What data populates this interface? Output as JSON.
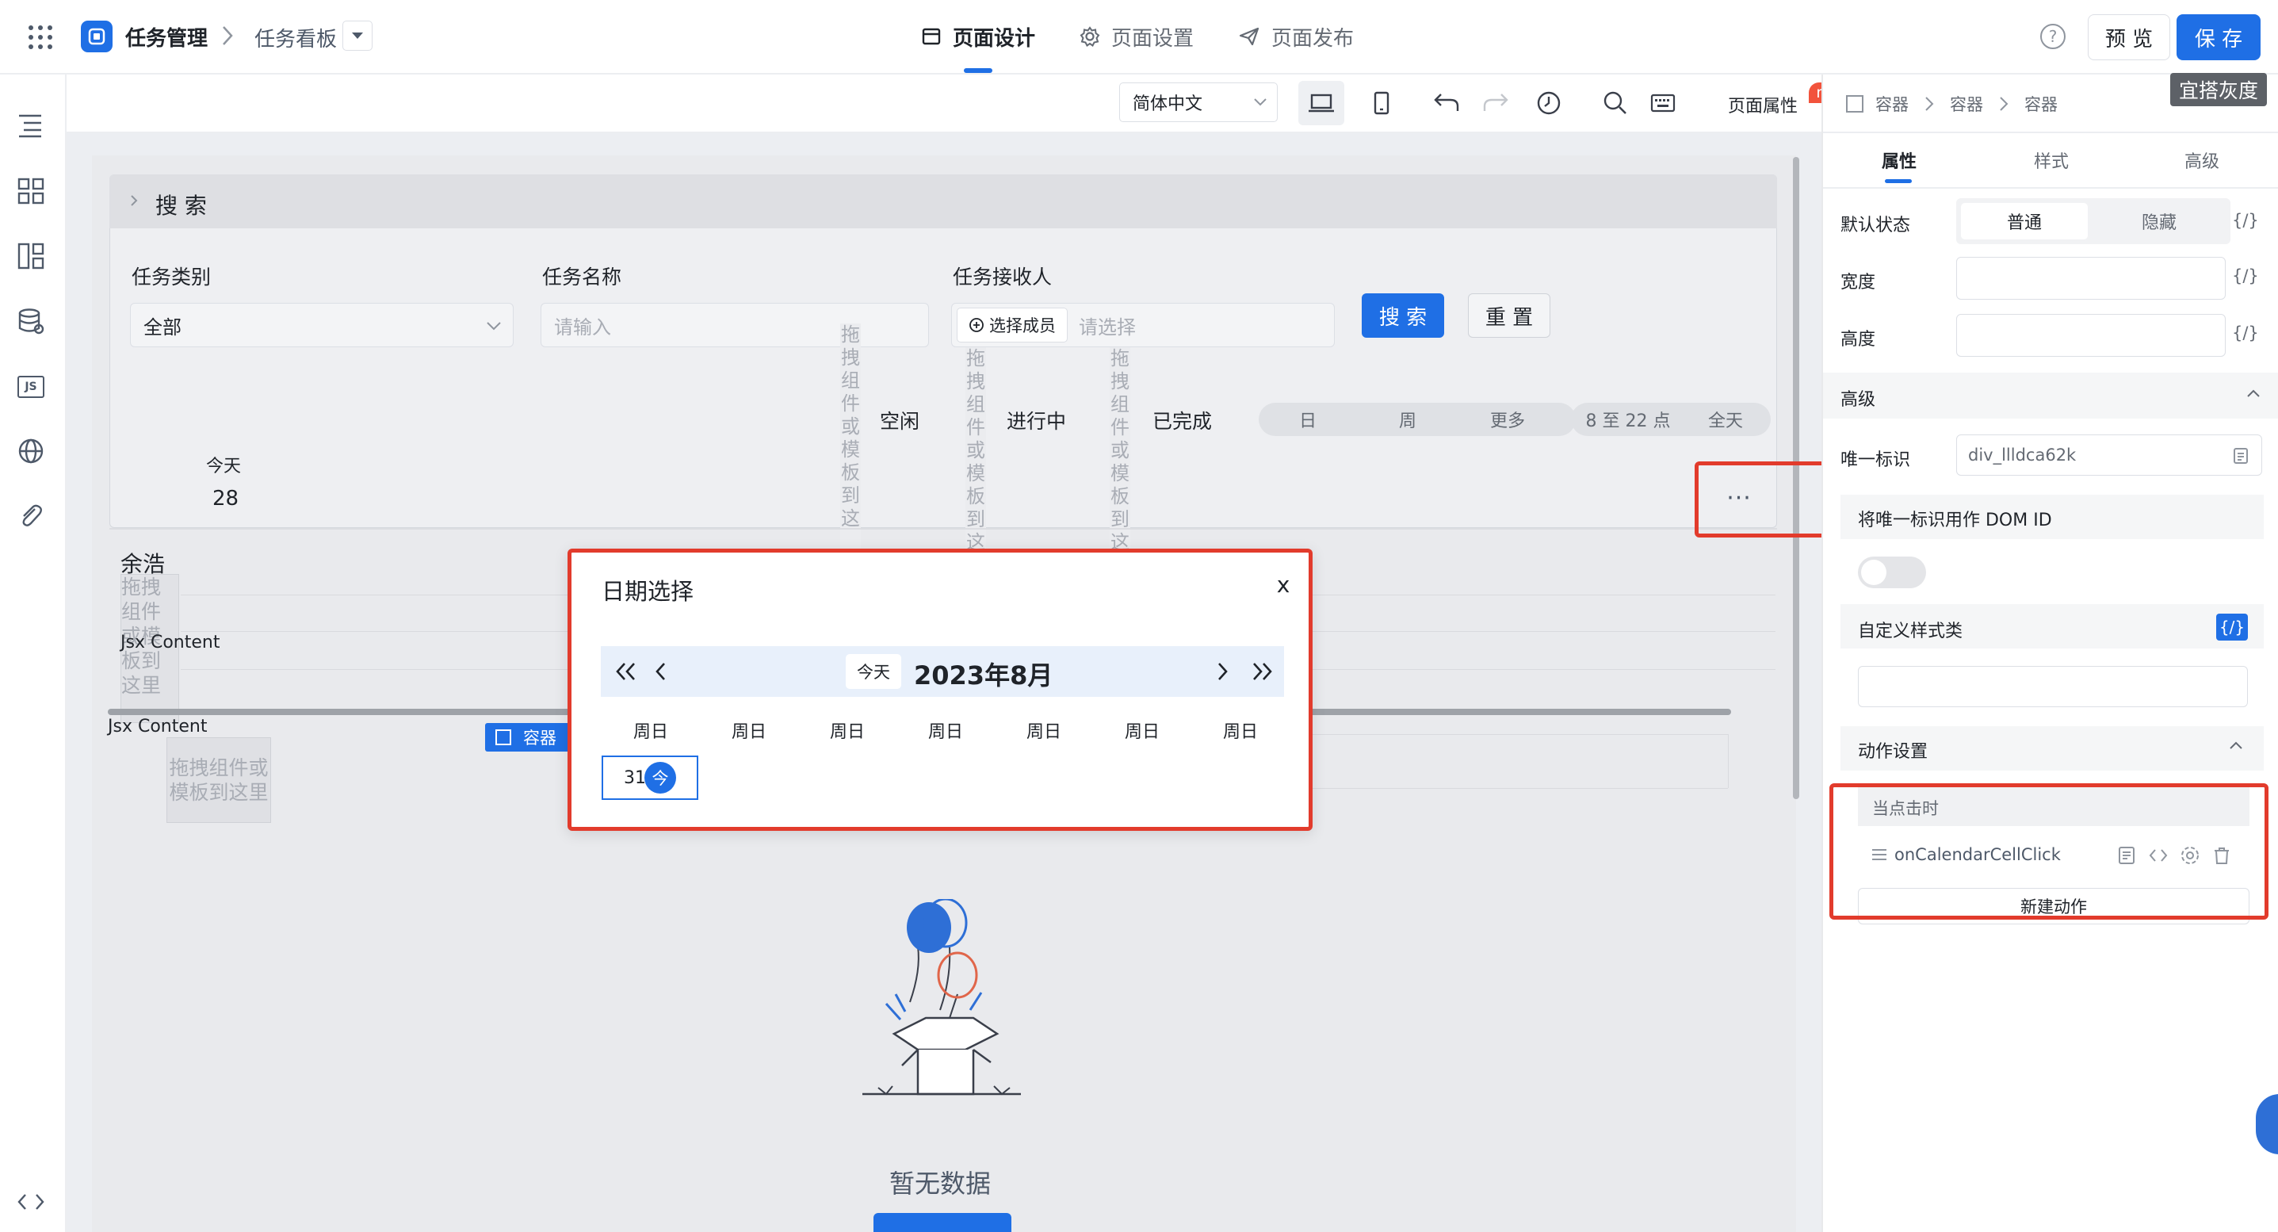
{
  "header": {
    "app_name": "任务管理",
    "breadcrumb_sep": ">",
    "page_name": "任务看板",
    "tabs": [
      {
        "label": "页面设计",
        "active": true
      },
      {
        "label": "页面设置"
      },
      {
        "label": "页面发布"
      }
    ],
    "preview_label": "预 览",
    "save_label": "保 存",
    "tooltip": "宜搭灰度"
  },
  "toolbar": {
    "language": "简体中文",
    "page_props_label": "页面属性",
    "new_badge": "new"
  },
  "canvas": {
    "search_title": "搜 索",
    "fields": [
      {
        "label": "任务类别",
        "value": "全部"
      },
      {
        "label": "任务名称",
        "placeholder": "请输入"
      },
      {
        "label": "任务接收人",
        "member_button": "选择成员",
        "placeholder": "请选择"
      }
    ],
    "search_button": "搜 索",
    "reset_button": "重 置",
    "drag_hint_vertical": "拖拽组件或模板到这",
    "status": [
      "空闲",
      "进行中",
      "已完成"
    ],
    "view_tabs": [
      "日",
      "周",
      "更多"
    ],
    "hours": "8 至 22 点",
    "all_day": "全天",
    "today_label": "今天",
    "today_day": "28",
    "person": "余浩",
    "drag_hint_small": "拖拽组件或模板到这里",
    "jsx1": "Jsx Content",
    "jsx2": "Jsx Content",
    "drag_hint_block": "拖拽组件或模板到这里",
    "container_tag": "容器",
    "empty_text": "暂无数据"
  },
  "dialog": {
    "title": "日期选择",
    "close": "x",
    "today_button": "今天",
    "month": "2023年8月",
    "weekdays": [
      "周日",
      "周日",
      "周日",
      "周日",
      "周日",
      "周日",
      "周日"
    ],
    "cell_day": "31",
    "cell_today": "今"
  },
  "panel": {
    "breadcrumb": [
      "容器",
      "容器",
      "容器"
    ],
    "tabs": [
      "属性",
      "样式",
      "高级"
    ],
    "default_state_label": "默认状态",
    "state_normal": "普通",
    "state_hidden": "隐藏",
    "width_label": "宽度",
    "height_label": "高度",
    "code_label": "{/}",
    "advanced_title": "高级",
    "uid_label": "唯一标识",
    "uid_value": "div_llldca62k",
    "dom_id_label": "将唯一标识用作 DOM ID",
    "custom_class_label": "自定义样式类",
    "action_title": "动作设置",
    "on_click": "当点击时",
    "action_name": "onCalendarCellClick",
    "new_action": "新建动作"
  }
}
